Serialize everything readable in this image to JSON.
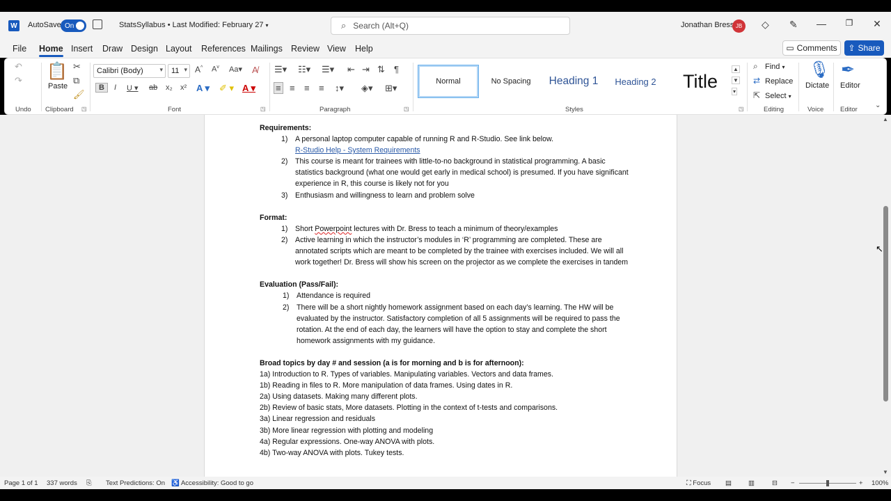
{
  "titlebar": {
    "autosave_label": "AutoSave",
    "autosave_state": "On",
    "doc_title": "StatsSyllabus • Last Modified: February 27",
    "search_placeholder": "Search (Alt+Q)",
    "user_name": "Jonathan Bress",
    "user_initials": "JB"
  },
  "menu": {
    "tabs": [
      "File",
      "Home",
      "Insert",
      "Draw",
      "Design",
      "Layout",
      "References",
      "Mailings",
      "Review",
      "View",
      "Help"
    ],
    "active": "Home",
    "comments": "Comments",
    "share": "Share"
  },
  "ribbon": {
    "groups": {
      "undo": "Undo",
      "clipboard": "Clipboard",
      "font": "Font",
      "paragraph": "Paragraph",
      "styles": "Styles",
      "editing": "Editing",
      "voice": "Voice",
      "editor": "Editor"
    },
    "paste": "Paste",
    "font_name": "Calibri (Body)",
    "font_size": "11",
    "styles": [
      "Normal",
      "No Spacing",
      "Heading 1",
      "Heading 2",
      "Title"
    ],
    "find": "Find",
    "replace": "Replace",
    "select": "Select",
    "dictate": "Dictate",
    "editor_btn": "Editor"
  },
  "document": {
    "req_heading": "Requirements:",
    "req_items": [
      [
        "1)",
        "A personal laptop computer capable of running R and R-Studio.  See link below."
      ],
      [
        "2)",
        "This course is meant for trainees with little-to-no background in statistical programming.  A basic statistics background (what one would get early in medical school) is presumed.  If you have significant experience in R, this course is likely not for you"
      ],
      [
        "3)",
        "Enthusiasm and willingness to learn and problem solve"
      ]
    ],
    "req_link": "R-Studio Help - System Requirements",
    "format_heading": "Format:",
    "format_items": [
      [
        "1)",
        "Short ",
        "Powerpoint",
        " lectures with Dr. Bress to teach a minimum of theory/examples"
      ],
      [
        "2)",
        "Active learning in which the instructor’s modules in ‘R’ programming are completed.  These are annotated scripts which are meant to be completed by the trainee with exercises included.  We will all work together!  Dr. Bress will show his screen on the projector as we complete the exercises in tandem"
      ]
    ],
    "eval_heading": "Evaluation (Pass/Fail):",
    "eval_items": [
      [
        "1)",
        "Attendance is required"
      ],
      [
        "2)",
        "There will be a short nightly homework assignment based on each day’s learning.  The HW will be evaluated by the instructor.  Satisfactory completion of all 5 assignments will be required to pass the rotation.  At the end of each day, the learners will have the option to stay and complete the short homework assignments with my guidance."
      ]
    ],
    "topics_heading": "Broad topics by day # and session (a is for morning and b is for afternoon):",
    "topics": [
      "1a) Introduction to R.  Types of variables.  Manipulating variables.  Vectors and data frames.",
      "1b) Reading in files to R.  More manipulation of data frames.  Using dates in R.",
      "2a) Using datasets.  Making many different plots.",
      "2b) Review of basic stats, More datasets.  Plotting in the context of t-tests and comparisons.",
      "3a) Linear regression and residuals",
      "3b) More linear regression with plotting and modeling",
      "4a) Regular expressions.  One-way ANOVA with plots.",
      "4b) Two-way ANOVA with plots.  Tukey tests."
    ]
  },
  "status": {
    "page": "Page 1 of 1",
    "words": "337 words",
    "text_predictions": "Text Predictions: On",
    "accessibility": "Accessibility: Good to go",
    "focus": "Focus",
    "zoom": "100%"
  }
}
